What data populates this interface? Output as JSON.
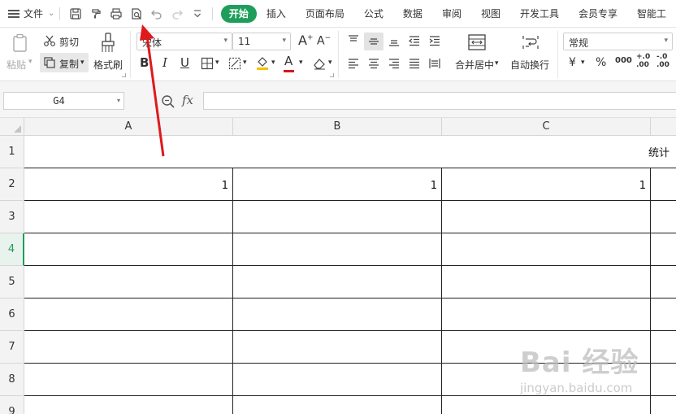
{
  "menubar": {
    "file_label": "文件",
    "tabs": [
      "开始",
      "插入",
      "页面布局",
      "公式",
      "数据",
      "审阅",
      "视图",
      "开发工具",
      "会员专享",
      "智能工"
    ],
    "active_tab": "开始",
    "quick_icons": [
      "save-icon",
      "format-painter-icon",
      "print-icon",
      "print-preview-icon",
      "undo-icon",
      "redo-icon",
      "customize-chevron-icon"
    ]
  },
  "ribbon": {
    "clipboard": {
      "paste_label": "粘贴",
      "cut_label": "剪切",
      "copy_label": "复制",
      "format_painter_label": "格式刷"
    },
    "font": {
      "font_name": "宋体",
      "font_size": "11",
      "bold_label": "B",
      "italic_label": "I",
      "underline_label": "U",
      "font_color_label": "A"
    },
    "alignment": {
      "merge_label": "合并居中",
      "wrap_label": "自动换行"
    },
    "number": {
      "format": "常规",
      "currency": "¥",
      "percent": "%",
      "thousands": "000",
      "inc_decimal": "+.0\n.00",
      "dec_decimal": "-.0\n.00"
    },
    "accent_color": "#1e9e5a"
  },
  "formula_bar": {
    "cell_ref": "G4",
    "fx_label": "fx",
    "formula": ""
  },
  "sheet": {
    "columns": [
      "A",
      "B",
      "C"
    ],
    "rows": [
      "1",
      "2",
      "3",
      "4",
      "5",
      "6",
      "7",
      "8",
      "9"
    ],
    "active_row": "4",
    "row1_text": "统计",
    "row2_values": [
      "1",
      "1",
      "1"
    ]
  },
  "watermark": {
    "brand": "Bai 经验",
    "url": "jingyan.baidu.com"
  },
  "annotation": {
    "arrow_color": "#e0191d"
  }
}
